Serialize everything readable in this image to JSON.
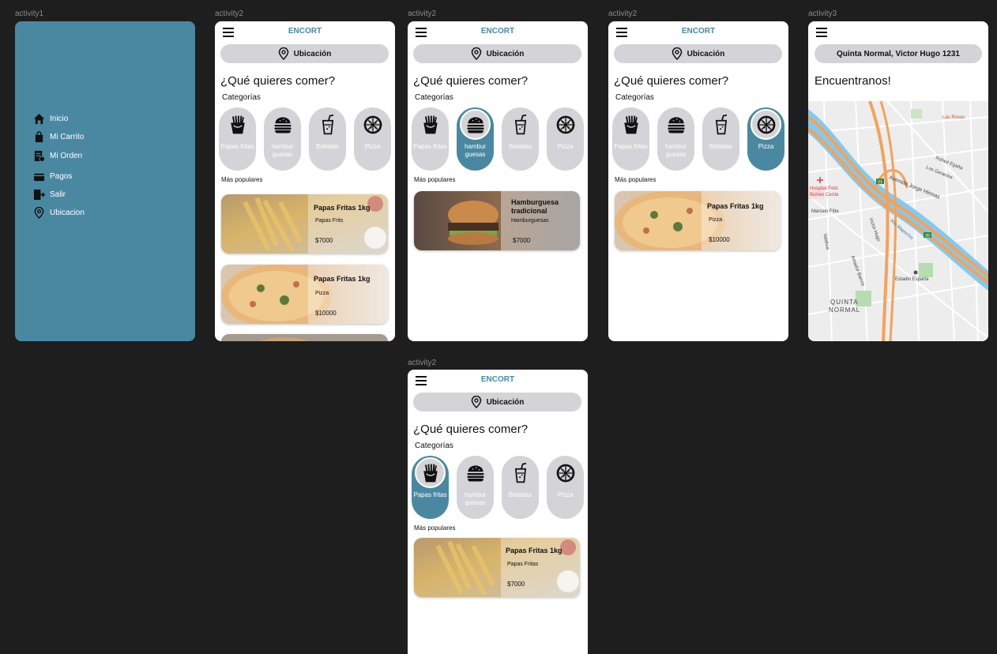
{
  "frames": {
    "activity1": "activity1",
    "activity2_a": "activity2",
    "activity2_b": "activity2",
    "activity2_c": "activity2",
    "activity2_d": "activity2",
    "activity3": "activity3"
  },
  "drawer": {
    "items": [
      {
        "label": "Inicio",
        "icon": "home-icon"
      },
      {
        "label": "Mi Carrito",
        "icon": "shopping-bag-icon"
      },
      {
        "label": "Mi Orden",
        "icon": "receipt-icon"
      },
      {
        "label": "Pagos",
        "icon": "wallet-icon"
      },
      {
        "label": "Salir",
        "icon": "logout-icon"
      },
      {
        "label": "Ubicacion",
        "icon": "location-pin-icon"
      }
    ],
    "background": "#4a88a2"
  },
  "home": {
    "brand": "ENCORT",
    "location_label": "Ubicación",
    "question": "¿Qué quieres comer?",
    "categories_title": "Categorías",
    "categories": [
      {
        "label": "Papas fritas",
        "icon": "fries-icon"
      },
      {
        "label": "hambur guesas",
        "icon": "burger-icon"
      },
      {
        "label": "Bebidas",
        "icon": "drink-icon"
      },
      {
        "label": "Pizza",
        "icon": "pizza-icon"
      }
    ],
    "popular_title": "Más populares"
  },
  "screen_a": {
    "cards": [
      {
        "name": "Papas Fritas 1kg",
        "category": "Papas Frits",
        "price": "$7000"
      },
      {
        "name": "Papas Fritas 1kg",
        "category": "Pizza",
        "price": "$10000"
      }
    ]
  },
  "screen_b": {
    "selected": "hambur guesas",
    "cards": [
      {
        "name": "Hamburguesa tradicional",
        "category": "Hamburguesas",
        "price": "$7000"
      }
    ]
  },
  "screen_c": {
    "selected": "Pizza",
    "cards": [
      {
        "name": "Papas Fritas 1kg",
        "category": "Pizza",
        "price": "$10000"
      }
    ]
  },
  "screen_d": {
    "selected": "Papas fritas",
    "cards": [
      {
        "name": "Papas Fritas 1kg",
        "category": "Papas Fritas",
        "price": "$7000"
      }
    ]
  },
  "location_screen": {
    "address": "Quinta Normal, Victor Hugo 1231",
    "title": "Encuentranos!",
    "map_labels": {
      "las_rosas": "Las Rosas",
      "rafael_egana": "Rafael Egaña",
      "los_geranios": "Los Geranios",
      "avenida_jorge_hirmas": "Avenida Jorge Hirmas",
      "hospital": "Hospital Feliz Bulnes Cerda",
      "marcelo_fitte": "Marcelo Fitte",
      "victor_hugo": "Victor Hugo",
      "valdivia": "Valdivia",
      "amador_barros": "Amador Barros",
      "rio_mapocho": "Río Mapocho",
      "estadio": "Estadio Esparta",
      "quinta": "QUINTA",
      "normal": "NORMAL",
      "shield_21": "21",
      "shield_20": "20"
    }
  },
  "colors": {
    "accent": "#4a88a2",
    "pill": "#d4d4d8",
    "canvas": "#1e1e1e"
  }
}
